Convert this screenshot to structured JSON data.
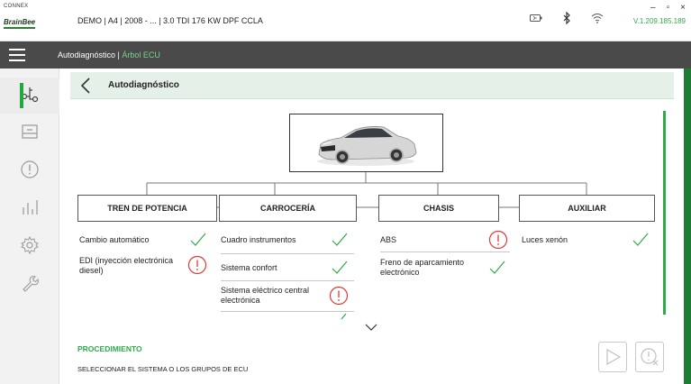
{
  "header": {
    "logo_top": "CONNEX",
    "logo_brand": "BrainBee",
    "vehicle": "DEMO | A4 | 2008 - ... | 3.0 TDI 176 KW DPF CCLA",
    "version": "V.1.209.185.189",
    "window_controls": {
      "minimize": "–",
      "maximize": "▫",
      "close": "×"
    },
    "icons": [
      "battery-icon",
      "bluetooth-icon",
      "wifi-icon"
    ]
  },
  "nav": {
    "breadcrumb_root": "Autodiagnóstico",
    "breadcrumb_sep": " | ",
    "breadcrumb_active": "Árbol ECU"
  },
  "sidebar": {
    "items": [
      {
        "icon": "ecu-tree-icon",
        "active": true
      },
      {
        "icon": "printer-icon",
        "active": false
      },
      {
        "icon": "alert-icon",
        "active": false
      },
      {
        "icon": "bars-icon",
        "active": false
      },
      {
        "icon": "settings-icon",
        "active": false
      },
      {
        "icon": "wrench-icon",
        "active": false
      }
    ]
  },
  "content": {
    "title": "Autodiagnóstico"
  },
  "categories": [
    {
      "label": "TREN DE POTENCIA",
      "items": [
        {
          "label": "Cambio automático",
          "status": "ok"
        },
        {
          "label": "EDI (inyección electrónica diesel)",
          "status": "error"
        }
      ]
    },
    {
      "label": "CARROCERÍA",
      "items": [
        {
          "label": "Cuadro instrumentos",
          "status": "ok"
        },
        {
          "label": "Sistema confort",
          "status": "ok"
        },
        {
          "label": "Sistema eléctrico central electrónica",
          "status": "error"
        },
        {
          "label": "",
          "status": "ok"
        }
      ]
    },
    {
      "label": "CHASIS",
      "items": [
        {
          "label": "ABS",
          "status": "error"
        },
        {
          "label": "Freno de aparcamiento electrónico",
          "status": "ok"
        }
      ]
    },
    {
      "label": "AUXILIAR",
      "items": [
        {
          "label": "Luces xenón",
          "status": "ok"
        }
      ]
    }
  ],
  "procedure": {
    "title": "PROCEDIMIENTO",
    "text": "SELECCIONAR EL SISTEMA O LOS GRUPOS DE ECU"
  },
  "colors": {
    "accent": "#2eaa4a",
    "error": "#e53935",
    "dark_bar": "#4a4a4a",
    "header_bg": "#e5f0e8"
  }
}
